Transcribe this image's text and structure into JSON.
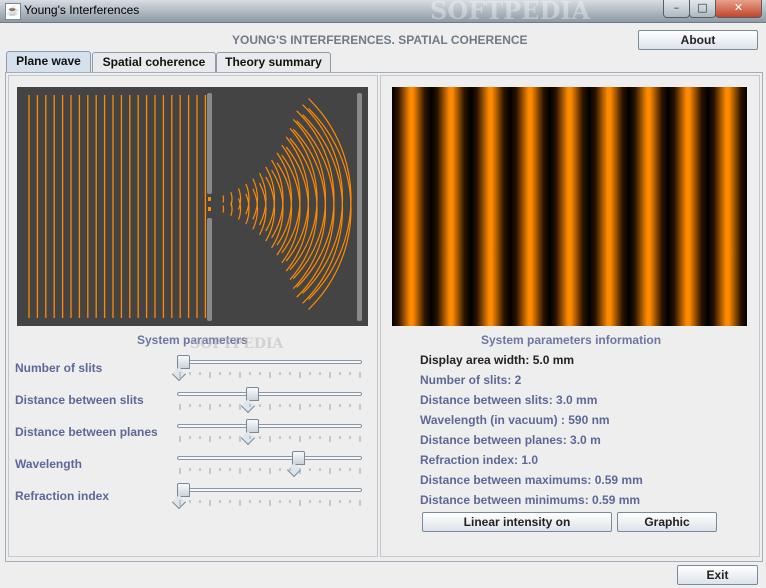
{
  "window": {
    "title": "Young's Interferences"
  },
  "app": {
    "heading": "YOUNG'S INTERFERENCES. SPATIAL COHERENCE",
    "about_label": "About"
  },
  "tabs": [
    {
      "label": "Plane wave",
      "active": true
    },
    {
      "label": "Spatial coherence",
      "active": false
    },
    {
      "label": "Theory summary",
      "active": false
    }
  ],
  "left": {
    "section_title": "System parameters",
    "params": [
      {
        "label": "Number of slits",
        "position": 0.0
      },
      {
        "label": "Distance between slits",
        "position": 0.4
      },
      {
        "label": "Distance between planes",
        "position": 0.4
      },
      {
        "label": "Wavelength",
        "position": 0.67
      },
      {
        "label": "Refraction index",
        "position": 0.0
      }
    ]
  },
  "right": {
    "section_title": "System parameters information",
    "display_area": "Display area width: 5.0 mm",
    "lines": [
      "Number of slits: 2",
      "Distance between slits: 3.0 mm",
      "Wavelength (in vacuum) : 590 nm",
      "Distance between planes: 3.0 m",
      "Refraction index: 1.0",
      "Distance between maximums: 0.59 mm",
      "Distance between minimums: 0.59 mm"
    ],
    "linear_button": "Linear intensity on",
    "graphic_button": "Graphic"
  },
  "footer": {
    "exit_label": "Exit"
  },
  "colors": {
    "wave": "#ff8a00",
    "canvas_bg": "#444444",
    "label": "#5d6899"
  }
}
